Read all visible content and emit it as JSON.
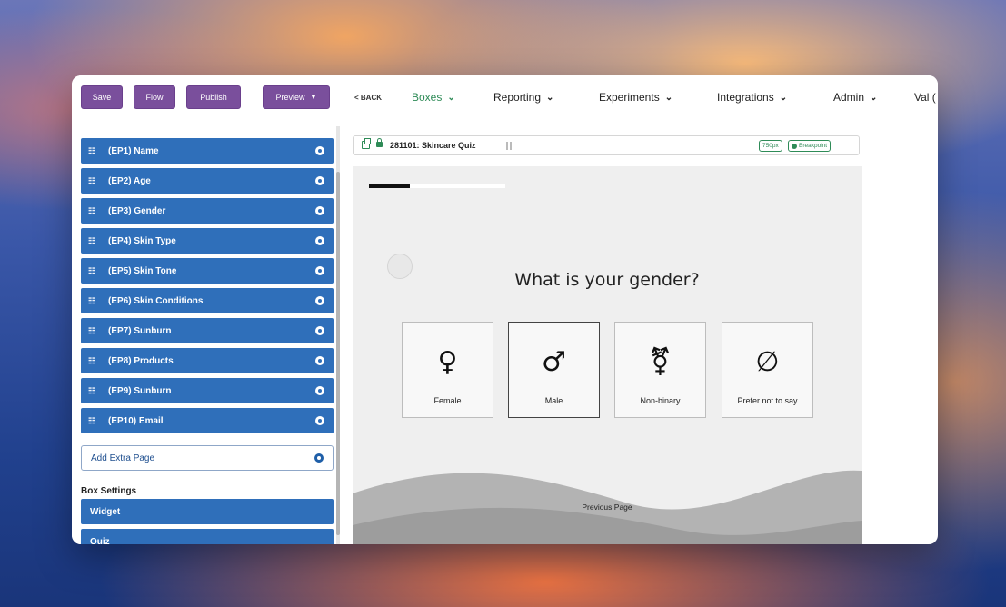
{
  "toolbar": {
    "save_label": "Save",
    "flow_label": "Flow",
    "publish_label": "Publish",
    "preview_label": "Preview",
    "accent_color": "#7a4f9c"
  },
  "nav": {
    "back_label": "< BACK",
    "items": [
      {
        "label": "Boxes",
        "active": true
      },
      {
        "label": "Reporting"
      },
      {
        "label": "Experiments"
      },
      {
        "label": "Integrations"
      },
      {
        "label": "Admin"
      }
    ],
    "user_label": "Val ("
  },
  "sidebar": {
    "pages": [
      {
        "label": "(EP1) Name"
      },
      {
        "label": "(EP2) Age"
      },
      {
        "label": "(EP3) Gender"
      },
      {
        "label": "(EP4) Skin Type"
      },
      {
        "label": "(EP5) Skin Tone"
      },
      {
        "label": "(EP6) Skin Conditions"
      },
      {
        "label": "(EP7) Sunburn"
      },
      {
        "label": "(EP8) Products"
      },
      {
        "label": "(EP9) Sunburn"
      },
      {
        "label": "(EP10) Email"
      }
    ],
    "add_page_label": "Add Extra Page",
    "box_settings_label": "Box Settings",
    "settings_items": [
      {
        "label": "Widget"
      },
      {
        "label": "Quiz"
      }
    ],
    "item_color": "#2f6fba"
  },
  "editor": {
    "box_title": "281101: Skincare Quiz",
    "width_badge": "750px",
    "breakpoint_badge": "Breakpoint"
  },
  "quiz": {
    "progress_fraction": 0.3,
    "question": "What is your gender?",
    "options": [
      {
        "label": "Female",
        "glyph": "♀",
        "icon": "female-symbol"
      },
      {
        "label": "Male",
        "glyph": "♂",
        "icon": "male-symbol",
        "selected": true
      },
      {
        "label": "Non-binary",
        "glyph": "⚧",
        "icon": "transgender-symbol"
      },
      {
        "label": "Prefer not to say",
        "glyph": "∅",
        "icon": "empty-set-symbol"
      }
    ],
    "previous_label": "Previous Page"
  }
}
